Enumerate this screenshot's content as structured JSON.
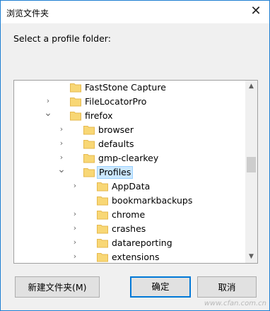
{
  "window": {
    "title": "浏览文件夹",
    "close_glyph": "✕"
  },
  "prompt": "Select a profile folder:",
  "tree": {
    "items": [
      {
        "label": "FastStone Capture",
        "level": 0,
        "chevron": "none"
      },
      {
        "label": "FileLocatorPro",
        "level": 0,
        "chevron": "collapsed"
      },
      {
        "label": "firefox",
        "level": 0,
        "chevron": "expanded"
      },
      {
        "label": "browser",
        "level": 1,
        "chevron": "collapsed"
      },
      {
        "label": "defaults",
        "level": 1,
        "chevron": "collapsed"
      },
      {
        "label": "gmp-clearkey",
        "level": 1,
        "chevron": "collapsed"
      },
      {
        "label": "Profiles",
        "level": 1,
        "chevron": "expanded",
        "selected": true
      },
      {
        "label": "AppData",
        "level": 2,
        "chevron": "collapsed"
      },
      {
        "label": "bookmarkbackups",
        "level": 2,
        "chevron": "none"
      },
      {
        "label": "chrome",
        "level": 2,
        "chevron": "collapsed"
      },
      {
        "label": "crashes",
        "level": 2,
        "chevron": "collapsed"
      },
      {
        "label": "datareporting",
        "level": 2,
        "chevron": "collapsed"
      },
      {
        "label": "extensions",
        "level": 2,
        "chevron": "collapsed"
      }
    ],
    "scroll_position": 0.45
  },
  "buttons": {
    "new_folder": "新建文件夹(M)",
    "ok": "确定",
    "cancel": "取消"
  },
  "watermark": "www.cfan.com.cn",
  "colors": {
    "folder": "#f8d775",
    "folder_dark": "#e6b94e",
    "selection": "#cce8ff",
    "accent": "#0078d7"
  }
}
